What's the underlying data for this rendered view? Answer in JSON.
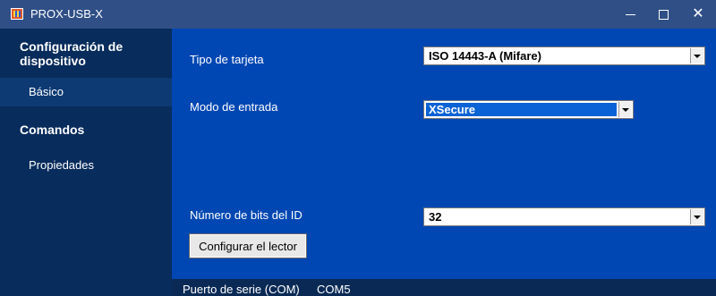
{
  "window": {
    "title": "PROX-USB-X",
    "icon": "app-icon",
    "controls": [
      "minimize-icon",
      "maximize-icon",
      "close-icon"
    ]
  },
  "sidebar": {
    "groups": [
      {
        "label": "Configuración de dispositivo"
      },
      {
        "label": "Comandos"
      }
    ],
    "items": [
      {
        "label": "Básico",
        "selected": true
      },
      {
        "label": "Propiedades",
        "selected": false
      }
    ]
  },
  "main": {
    "tipo_tarjeta": {
      "label": "Tipo de tarjeta",
      "value": "ISO 14443-A (Mifare)"
    },
    "modo_entrada": {
      "label": "Modo de entrada",
      "value": "XSecure"
    },
    "bits_id": {
      "label": "Número de bits del ID",
      "value": "32"
    },
    "configure_button": "Configurar el lector"
  },
  "status": {
    "port_label": "Puerto de serie (COM)",
    "port_value": "COM5"
  },
  "colors": {
    "titlebar": "#2f4f86",
    "sidebar": "#082c5c",
    "sidebar_selected": "#0d3a73",
    "content": "#0047b3",
    "selection": "#0a63d6"
  }
}
